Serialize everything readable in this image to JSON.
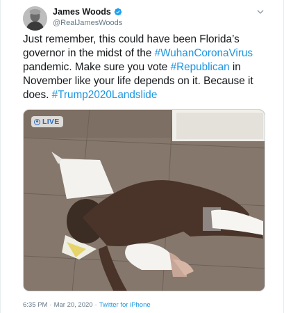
{
  "author": {
    "display_name": "James Woods",
    "handle": "@RealJamesWoods",
    "verified_icon": "verified-badge-icon",
    "avatar": "author-avatar"
  },
  "tweet": {
    "segments": [
      {
        "text": "Just remember, this could have been Florida’s governor in the midst of the ",
        "hashtag": false
      },
      {
        "text": "#WuhanCoronaVirus",
        "hashtag": true
      },
      {
        "text": " pandemic. Make sure you vote ",
        "hashtag": false
      },
      {
        "text": "#Republican",
        "hashtag": true
      },
      {
        "text": " in November like your life depends on it. Because it does. ",
        "hashtag": false
      },
      {
        "text": "#Trump2020Landslide",
        "hashtag": true
      }
    ]
  },
  "media": {
    "live_label": "LIVE",
    "description": "photo"
  },
  "meta": {
    "time": "6:35 PM",
    "separator_1": "·",
    "date": "Mar 20, 2020",
    "separator_2": "·",
    "source": "Twitter for iPhone"
  },
  "colors": {
    "link": "#1b95e0",
    "verified": "#1da1f2",
    "muted": "#657786"
  }
}
